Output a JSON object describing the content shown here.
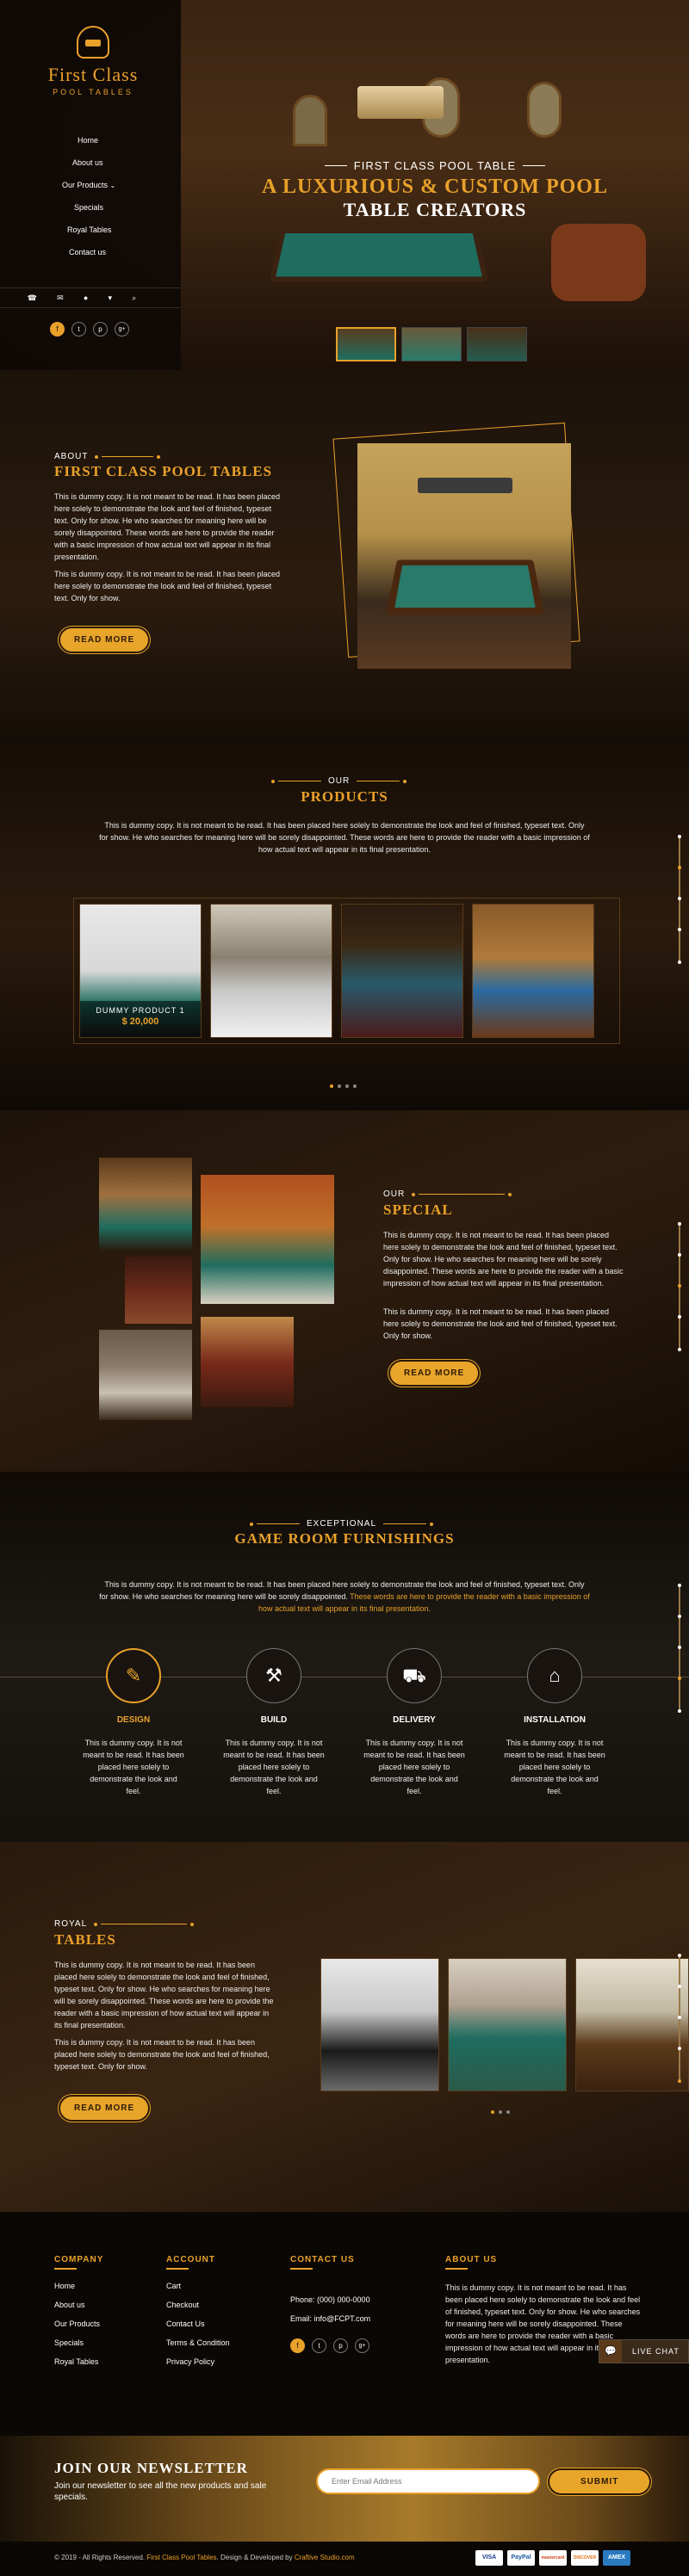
{
  "brand": {
    "name": "First Class",
    "tagline": "POOL TABLES"
  },
  "nav": [
    {
      "label": "Home"
    },
    {
      "label": "About us"
    },
    {
      "label": "Our Products"
    },
    {
      "label": "Specials"
    },
    {
      "label": "Royal Tables"
    },
    {
      "label": "Contact us"
    }
  ],
  "hero": {
    "kicker": "FIRST CLASS POOL TABLE",
    "title_line1": "A LUXURIOUS & CUSTOM POOL",
    "title_line2": "TABLE CREATORS"
  },
  "about": {
    "label": "ABOUT",
    "title": "FIRST CLASS POOL TABLES",
    "para1": "This is dummy copy. It is not meant to be read. It has been placed here solely to demonstrate the look and feel of finished, typeset text. Only for show. He who searches for meaning here will be sorely disappointed. These words are here to provide the reader with a basic impression of how actual text will appear in its final presentation.",
    "para2": "This is dummy copy. It is not meant to be read. It has been placed here solely to demonstrate the look and feel of finished, typeset text. Only for show.",
    "button": "READ MORE"
  },
  "products": {
    "label": "OUR",
    "title": "PRODUCTS",
    "intro": "This is dummy copy. It is not meant to be read. It has been placed here solely to demonstrate the look and feel of finished, typeset text. Only for show. He who searches for meaning here will be sorely disappointed. These words are here to provide the reader with a basic impression of how actual text will appear in its final presentation.",
    "items": [
      {
        "name": "DUMMY PRODUCT 1",
        "price": "$ 20,000"
      },
      {
        "name": "",
        "price": ""
      },
      {
        "name": "",
        "price": ""
      },
      {
        "name": "",
        "price": ""
      }
    ]
  },
  "special": {
    "label": "OUR",
    "title": "SPECIAL",
    "para1": "This is dummy copy. It is not meant to be read. It has been placed here solely to demonstrate the look and feel of finished, typeset text. Only for show. He who searches for meaning here will be sorely disappointed. These words are here to provide the reader with a basic impression of how actual text will appear in its final presentation.",
    "para2": "This is dummy copy. It is not meant to be read. It has been placed here solely to demonstrate the look and feel of finished, typeset text. Only for show.",
    "button": "READ MORE"
  },
  "furnishings": {
    "label": "EXCEPTIONAL",
    "title": "GAME ROOM FURNISHINGS",
    "intro_white": "This is dummy copy. It is not meant to be read. It has been placed here solely to demonstrate the look and feel of finished, typeset text. Only for show. He who searches for meaning here will be sorely disappointed.",
    "intro_gold": "These words are here to provide the reader with a basic impression of how actual text will appear in its final presentation.",
    "items": [
      {
        "title": "DESIGN",
        "text": "This is dummy copy. It is not meant to be read. It has been placed here solely to demonstrate the look and feel."
      },
      {
        "title": "BUILD",
        "text": "This is dummy copy. It is not meant to be read. It has been placed here solely to demonstrate the look and feel."
      },
      {
        "title": "DELIVERY",
        "text": "This is dummy copy. It is not meant to be read. It has been placed here solely to demonstrate the look and feel."
      },
      {
        "title": "INSTALLATION",
        "text": "This is dummy copy. It is not meant to be read. It has been placed here solely to demonstrate the look and feel."
      }
    ]
  },
  "royal": {
    "label": "ROYAL",
    "title": "TABLES",
    "para1": "This is dummy copy. It is not meant to be read. It has been placed here solely to demonstrate the look and feel of finished, typeset text. Only for show. He who searches for meaning here will be sorely disappointed. These words are here to provide the reader with a basic impression of how actual text will appear in its final presentation.",
    "para2": "This is dummy copy. It is not meant to be read. It has been placed here solely to demonstrate the look and feel of finished, typeset text. Only for show.",
    "button": "READ MORE"
  },
  "footer": {
    "company_title": "COMPANY",
    "company_links": [
      "Home",
      "About us",
      "Our Products",
      "Specials",
      "Royal Tables"
    ],
    "account_title": "ACCOUNT",
    "account_links": [
      "Cart",
      "Checkout",
      "Contact Us",
      "Terms & Condition",
      "Privacy Policy"
    ],
    "contact_title": "CONTACT US",
    "phone": "Phone: (000) 000-0000",
    "email": "Email: info@FCPT.com",
    "about_title": "ABOUT US",
    "about_text": "This is dummy copy. It is not meant to be read. It has been placed here solely to demonstrate the look and feel of finished, typeset text. Only for show. He who searches for meaning here will be sorely disappointed. These words are here to provide the reader with a basic impression of how actual text will appear in its final presentation.",
    "live_chat": "LIVE CHAT"
  },
  "newsletter": {
    "title": "JOIN OUR NEWSLETTER",
    "text": "Join our newsletter to see all the new products and sale specials.",
    "placeholder": "Enter Email Address",
    "button": "SUBMIT"
  },
  "copyright": {
    "text": "© 2019 - All Rights Reserved.",
    "brand": "First Class Pool Tables",
    "design": ". Design & Developed by",
    "studio": "Craftive Studio.com"
  },
  "payments": [
    "VISA",
    "PayPal",
    "mastercard",
    "DISCOVER",
    "AMEX"
  ],
  "colors": {
    "accent": "#e9a12a",
    "dark": "#0d0906",
    "felt": "#1f6d5f"
  }
}
